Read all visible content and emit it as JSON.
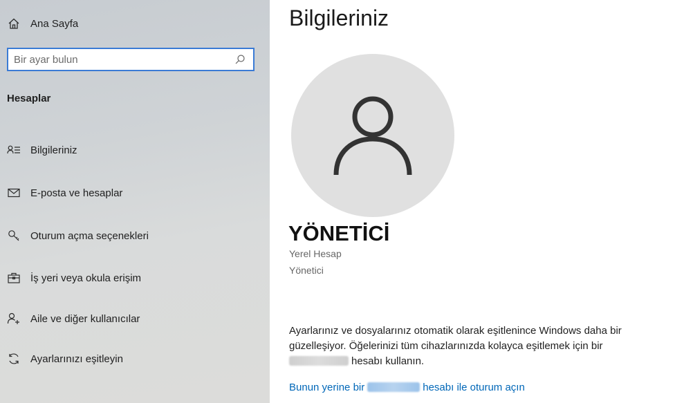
{
  "sidebar": {
    "home_label": "Ana Sayfa",
    "search_placeholder": "Bir ayar bulun",
    "section_title": "Hesaplar",
    "items": [
      {
        "label": "Bilgileriniz",
        "icon": "person-list-icon"
      },
      {
        "label": "E-posta ve hesaplar",
        "icon": "mail-icon"
      },
      {
        "label": "Oturum açma seçenekleri",
        "icon": "key-icon"
      },
      {
        "label": "İş yeri veya okula erişim",
        "icon": "briefcase-icon"
      },
      {
        "label": "Aile ve diğer kullanıcılar",
        "icon": "person-add-icon"
      },
      {
        "label": "Ayarlarınızı eşitleyin",
        "icon": "sync-icon"
      }
    ]
  },
  "main": {
    "title": "Bilgileriniz",
    "user_name": "YÖNETİCİ",
    "account_type": "Yerel Hesap",
    "role": "Yönetici",
    "description_line1": "Ayarlarınız ve dosyalarınız otomatik olarak eşitlenince Windows daha bir",
    "description_line2": "güzelleşiyor. Öğelerinizi tüm cihazlarınızda kolayca eşitlemek için bir",
    "description_line3_suffix": "hesabı kullanın.",
    "link_prefix": "Bunun yerine bir",
    "link_suffix": "hesabı ile oturum açın"
  },
  "colors": {
    "accent": "#3a7bd5",
    "link": "#0067b8",
    "avatar_bg": "#e0e0e0"
  }
}
